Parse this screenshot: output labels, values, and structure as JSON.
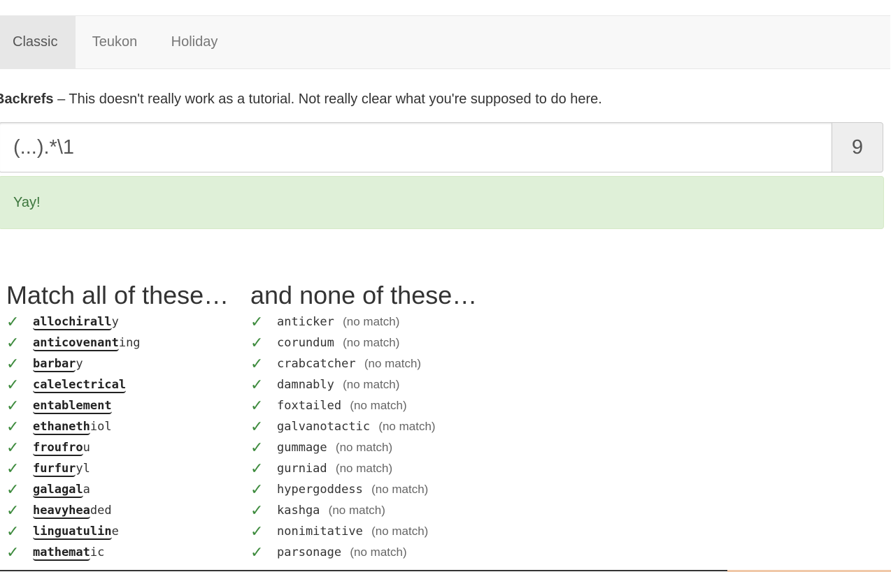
{
  "tabs": [
    {
      "label": "Classic",
      "active": true
    },
    {
      "label": "Teukon",
      "active": false
    },
    {
      "label": "Holiday",
      "active": false
    }
  ],
  "puzzle": {
    "name": "Backrefs",
    "separator": " – ",
    "description": "This doesn't really work as a tutorial. Not really clear what you're supposed to do here."
  },
  "regex": {
    "value": "(...).*\\1",
    "score": "9"
  },
  "alert": {
    "message": "Yay!",
    "color": "#dff0d8"
  },
  "match_column": {
    "heading": "Match all of these…",
    "items": [
      {
        "matched": "allochirall",
        "rest": "y"
      },
      {
        "matched": "anticovenant",
        "rest": "ing"
      },
      {
        "matched": "barbar",
        "rest": "y"
      },
      {
        "matched": "calelectrical",
        "rest": ""
      },
      {
        "matched": "entablement",
        "rest": ""
      },
      {
        "matched": "ethaneth",
        "rest": "iol"
      },
      {
        "matched": "froufro",
        "rest": "u"
      },
      {
        "matched": "furfur",
        "rest": "yl"
      },
      {
        "matched": "galagal",
        "rest": "a"
      },
      {
        "matched": "heavyhea",
        "rest": "ded"
      },
      {
        "matched": "linguatulin",
        "rest": "e"
      },
      {
        "matched": "mathemat",
        "rest": "ic"
      }
    ]
  },
  "none_column": {
    "heading": "and none of these…",
    "no_match_label": "(no match)",
    "items": [
      "anticker",
      "corundum",
      "crabcatcher",
      "damnably",
      "foxtailed",
      "galvanotactic",
      "gummage",
      "gurniad",
      "hypergoddess",
      "kashga",
      "nonimitative",
      "parsonage"
    ]
  },
  "check_glyph": "✓",
  "colors": {
    "check": "#3c8a3c",
    "navbar": "#f8f8f8",
    "active_tab": "#e7e7e7"
  }
}
